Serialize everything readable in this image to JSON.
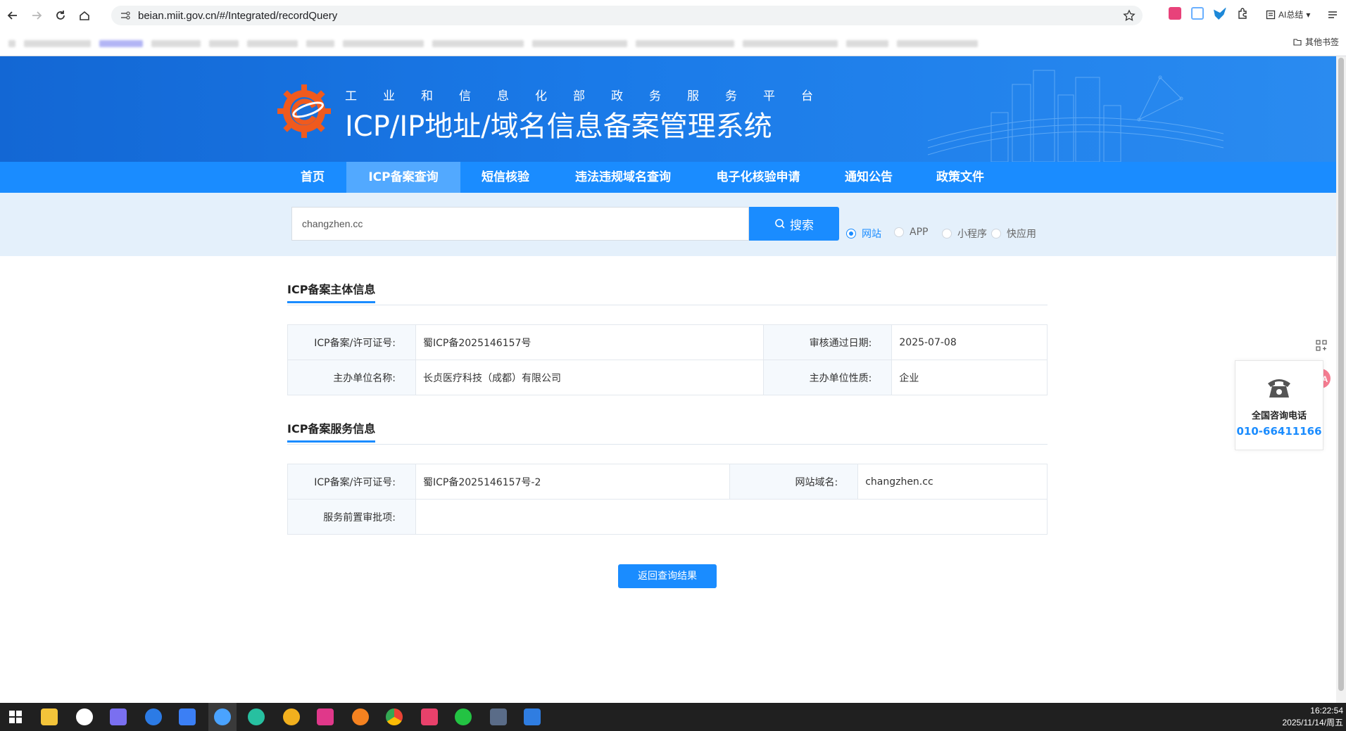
{
  "browser": {
    "url": "beian.miit.gov.cn/#/Integrated/recordQuery",
    "ai_summary_label": "AI总结",
    "other_bookmarks_label": "其他书签"
  },
  "header": {
    "subtitle": "工业和信息化部政务服务平台",
    "title": "ICP/IP地址/域名信息备案管理系统"
  },
  "nav": {
    "items": [
      {
        "label": "首页"
      },
      {
        "label": "ICP备案查询"
      },
      {
        "label": "短信核验"
      },
      {
        "label": "违法违规域名查询"
      },
      {
        "label": "电子化核验申请"
      },
      {
        "label": "通知公告"
      },
      {
        "label": "政策文件"
      }
    ],
    "active_index": 1
  },
  "search": {
    "value": "changzhen.cc",
    "button_label": "搜索",
    "types": [
      {
        "label": "网站",
        "checked": true
      },
      {
        "label": "APP",
        "checked": false
      },
      {
        "label": "小程序",
        "checked": false
      },
      {
        "label": "快应用",
        "checked": false
      }
    ]
  },
  "subject": {
    "title": "ICP备案主体信息",
    "rows": [
      {
        "label1": "ICP备案/许可证号:",
        "value1": "蜀ICP备2025146157号",
        "label2": "审核通过日期:",
        "value2": "2025-07-08"
      },
      {
        "label1": "主办单位名称:",
        "value1": "长贞医疗科技（成都）有限公司",
        "label2": "主办单位性质:",
        "value2": "企业"
      }
    ]
  },
  "service": {
    "title": "ICP备案服务信息",
    "row1": {
      "label1": "ICP备案/许可证号:",
      "value1": "蜀ICP备2025146157号-2",
      "label2": "网站域名:",
      "value2": "changzhen.cc"
    },
    "row2": {
      "label": "服务前置审批项:",
      "value": ""
    }
  },
  "return_button_label": "返回查询结果",
  "hotline": {
    "label": "全国咨询电话",
    "number": "010-66411166"
  },
  "side_tool_label": "文A",
  "taskbar": {
    "time": "16:22:54",
    "date": "2025/11/14/周五"
  },
  "colors": {
    "primary": "#1a8cff",
    "banner": "#1367d4",
    "nav_active": "#52a9ff",
    "search_band": "#e4f0fb"
  }
}
